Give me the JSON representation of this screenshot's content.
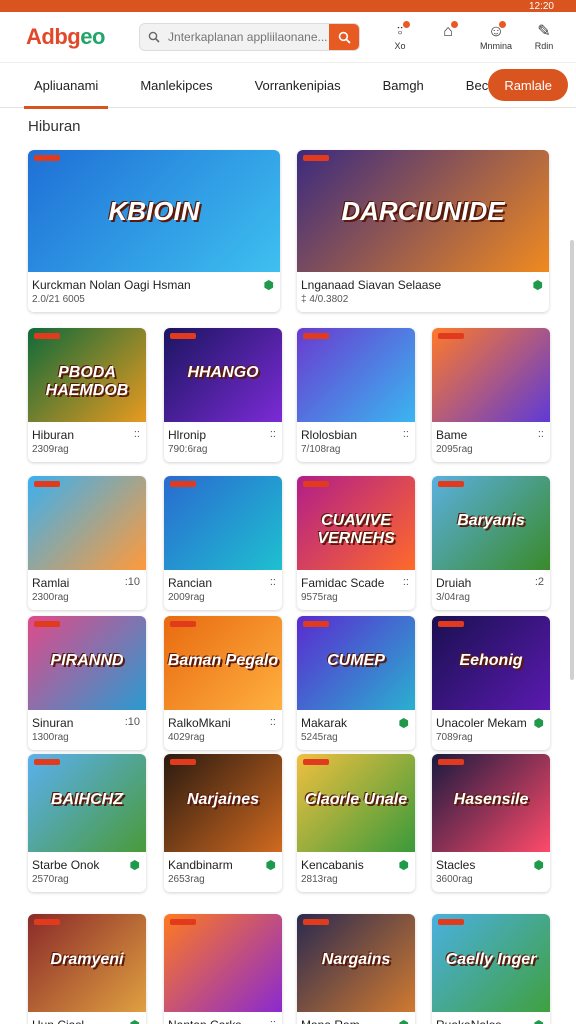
{
  "status": {
    "time": "12:20"
  },
  "header": {
    "logo_part1": "Adbg",
    "logo_part2": "eo",
    "search_placeholder": "Jnterkaplanan appliilaonane...",
    "icons": [
      {
        "name": "alert-icon",
        "glyph": "⍤",
        "label": "Xo"
      },
      {
        "name": "home-icon",
        "glyph": "⌂",
        "label": ""
      },
      {
        "name": "profile-icon",
        "glyph": "☺",
        "label": "Mnmina"
      },
      {
        "name": "edit-icon",
        "glyph": "✎",
        "label": "Rdin"
      }
    ]
  },
  "tabs": {
    "items": [
      "Apliuanami",
      "Manlekipces",
      "Vorrankenipias",
      "Bamgh",
      "Becka"
    ],
    "active_index": 0,
    "pill": "Ramlale"
  },
  "section": {
    "title": "Hiburan"
  },
  "featured": [
    {
      "art": "KBIOIN",
      "name": "Kurckman Nolan Oagi Hsman",
      "size": "2.0/21 6005",
      "icon": "green"
    },
    {
      "art": "DARCIUNIDE",
      "name": "Lnganaad Siavan Selaase",
      "size": "‡ 4/0.3802",
      "icon": "green"
    }
  ],
  "apps": [
    {
      "art": "PBODA HAEMDOB",
      "name": "Hiburan",
      "size": "2309rag",
      "icon": "::"
    },
    {
      "art": "HHANGO",
      "name": "Hlronip",
      "size": "790:6rag",
      "icon": "::"
    },
    {
      "art": "",
      "name": "Rlolosbian",
      "size": "7/108rag",
      "icon": "::"
    },
    {
      "art": "",
      "name": "Bame",
      "size": "2095rag",
      "icon": "::"
    },
    {
      "art": "",
      "name": "Ramlai",
      "size": "2300rag",
      "icon": ":10"
    },
    {
      "art": "",
      "name": "Rancian",
      "size": "2009rag",
      "icon": "::"
    },
    {
      "art": "CUAVIVE VERNEHS",
      "name": "Famidac Scade",
      "size": "9575rag",
      "icon": "::"
    },
    {
      "art": "Baryanis",
      "name": "Druiah",
      "size": "3/04rag",
      "icon": ":2"
    },
    {
      "art": "PIRANND",
      "name": "Sinuran",
      "size": "1300rag",
      "icon": ":10"
    },
    {
      "art": "Baman Pegalo",
      "name": "RalkoMkani",
      "size": "4029rag",
      "icon": "::"
    },
    {
      "art": "CUMEP",
      "name": "Makarak",
      "size": "5245rag",
      "icon": "green"
    },
    {
      "art": "Eehonig",
      "name": "Unacoler Mekam",
      "size": "7089rag",
      "icon": "green"
    },
    {
      "art": "BAIHCHZ",
      "name": "Starbe Onok",
      "size": "2570rag",
      "icon": "green"
    },
    {
      "art": "Narjaines",
      "name": "Kandbinarm",
      "size": "2653rag",
      "icon": "green"
    },
    {
      "art": "Claorle Unale",
      "name": "Kencabanis",
      "size": "2813rag",
      "icon": "green"
    },
    {
      "art": "Hasensile",
      "name": "Stacles",
      "size": "3600rag",
      "icon": "green"
    },
    {
      "art": "Dramyeni",
      "name": "Hun Ciasl",
      "size": "",
      "icon": "green"
    },
    {
      "art": "",
      "name": "Nantan Carks",
      "size": "",
      "icon": "::"
    },
    {
      "art": "Nargains",
      "name": "Mana Ram",
      "size": "",
      "icon": "green"
    },
    {
      "art": "Caelly Inger",
      "name": "RuakaNalos",
      "size": "",
      "icon": "green"
    }
  ],
  "colors": {
    "accent": "#d9541e",
    "green": "#1f9a4b"
  }
}
